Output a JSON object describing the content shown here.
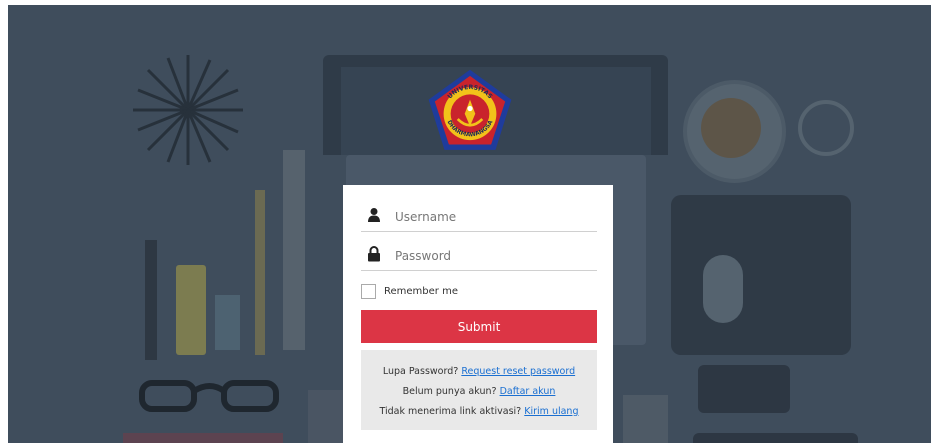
{
  "logo": {
    "text_top": "UNIVERSITAS",
    "text_bottom": "DHARMAWANGSA",
    "colors": {
      "blue": "#1f3c9c",
      "red": "#c9232c",
      "yellow": "#f2c21a"
    }
  },
  "form": {
    "username_placeholder": "Username",
    "password_placeholder": "Password",
    "remember_label": "Remember me",
    "submit_label": "Submit",
    "submit_color": "#dc3545"
  },
  "links": {
    "reset_prefix": "Lupa Password?",
    "reset_link": "Request reset password",
    "register_prefix": "Belum punya akun?",
    "register_link": "Daftar akun",
    "resend_prefix": "Tidak menerima link aktivasi?",
    "resend_link": "Kirim ulang",
    "link_color": "#1a6fd1"
  },
  "icons": {
    "username": "user-icon",
    "password": "lock-icon"
  }
}
